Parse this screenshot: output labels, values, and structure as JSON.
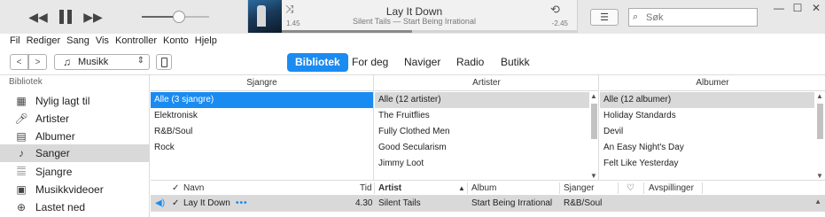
{
  "player": {
    "prev_icon": "rewind-icon",
    "pause_icon": "pause-icon",
    "next_icon": "fast-forward-icon",
    "volume_level": 0.5
  },
  "now_playing": {
    "title": "Lay It Down",
    "subtitle": "Silent Tails — Start Being Irrational",
    "elapsed": "1.45",
    "remaining": "-2.45",
    "progress": 0.44
  },
  "search": {
    "placeholder": "Søk"
  },
  "menu": [
    "Fil",
    "Rediger",
    "Sang",
    "Vis",
    "Kontroller",
    "Konto",
    "Hjelp"
  ],
  "nav": {
    "media_selector": "Musikk",
    "tabs": [
      "Bibliotek",
      "For deg",
      "Naviger",
      "Radio",
      "Butikk"
    ],
    "active_tab": "Bibliotek"
  },
  "sidebar": {
    "heading": "Bibliotek",
    "items": [
      {
        "label": "Nylig lagt til",
        "icon": "calendar-grid-icon"
      },
      {
        "label": "Artister",
        "icon": "microphone-icon"
      },
      {
        "label": "Albumer",
        "icon": "album-stack-icon"
      },
      {
        "label": "Sanger",
        "icon": "music-note-icon"
      },
      {
        "label": "Sjangre",
        "icon": "instruments-icon"
      },
      {
        "label": "Musikkvideoer",
        "icon": "music-video-icon"
      },
      {
        "label": "Lastet ned",
        "icon": "download-circle-icon"
      }
    ],
    "selected": "Sanger"
  },
  "browser": {
    "genres": {
      "header": "Sjangre",
      "rows": [
        "Alle (3 sjangre)",
        "Elektronisk",
        "R&B/Soul",
        "Rock"
      ]
    },
    "artists": {
      "header": "Artister",
      "rows": [
        "Alle (12 artister)",
        "The Fruitflies",
        "Fully Clothed Men",
        "Good Secularism",
        "Jimmy Loot"
      ]
    },
    "albums": {
      "header": "Albumer",
      "rows": [
        "Alle (12 albumer)",
        "Holiday Standards",
        "Devil",
        "An Easy Night's Day",
        "Felt Like Yesterday"
      ]
    }
  },
  "songs": {
    "columns": {
      "check": "✓",
      "name": "Navn",
      "time": "Tid",
      "artist": "Artist",
      "album": "Album",
      "genre": "Sjanger",
      "heart": "♡",
      "plays": "Avspillinger"
    },
    "rows": [
      {
        "check": "✓",
        "name": "Lay It Down",
        "more": "•••",
        "time": "4.30",
        "artist": "Silent Tails",
        "album": "Start Being Irrational",
        "genre": "R&B/Soul"
      }
    ]
  },
  "colors": {
    "accent": "#1a8bf1",
    "selection_gray": "#d9d9d9"
  }
}
